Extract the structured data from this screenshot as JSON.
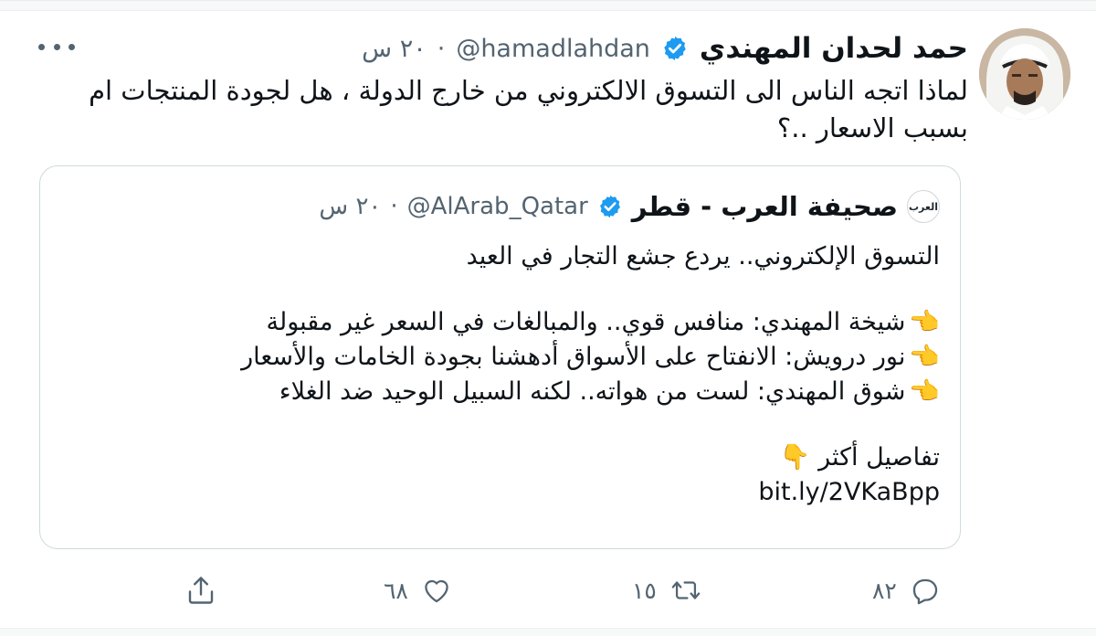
{
  "tweet": {
    "author": {
      "display_name": "حمد لحدان المهندي",
      "handle": "@hamadlahdan",
      "verified": true,
      "avatar_icon": "profile-photo"
    },
    "separator": "·",
    "time": "٢٠ س",
    "text": "لماذا اتجه الناس الى التسوق الالكتروني من خارج الدولة ، هل لجودة المنتجات ام\nبسبب الاسعار ..؟",
    "more_icon": "more-horizontal-icon",
    "quote": {
      "author": {
        "display_name": "صحيفة العرب - قطر",
        "handle": "@AlArab_Qatar",
        "verified": true,
        "avatar_text": "العرب"
      },
      "separator": "·",
      "time": "٢٠ س",
      "headline": "التسوق الإلكتروني.. يردع جشع التجار في العيد",
      "bullets": [
        "شيخة المهندي: منافس قوي.. والمبالغات في السعر غير مقبولة",
        "نور درويش: الانفتاح على الأسواق أدهشنا بجودة الخامات والأسعار",
        "شوق المهندي: لست من هواته.. لكنه السبيل الوحيد ضد الغلاء"
      ],
      "bullet_icon": "👈",
      "more_label": "تفاصيل أكثر",
      "more_icon": "👇",
      "link": "bit.ly/2VKaBpp"
    },
    "actions": {
      "reply_count": "٨٢",
      "retweet_count": "١٥",
      "like_count": "٦٨",
      "share_count": ""
    },
    "colors": {
      "verified": "#1d9bf0",
      "text": "#0f1419",
      "secondary": "#536471",
      "border": "#cfd9de"
    }
  }
}
